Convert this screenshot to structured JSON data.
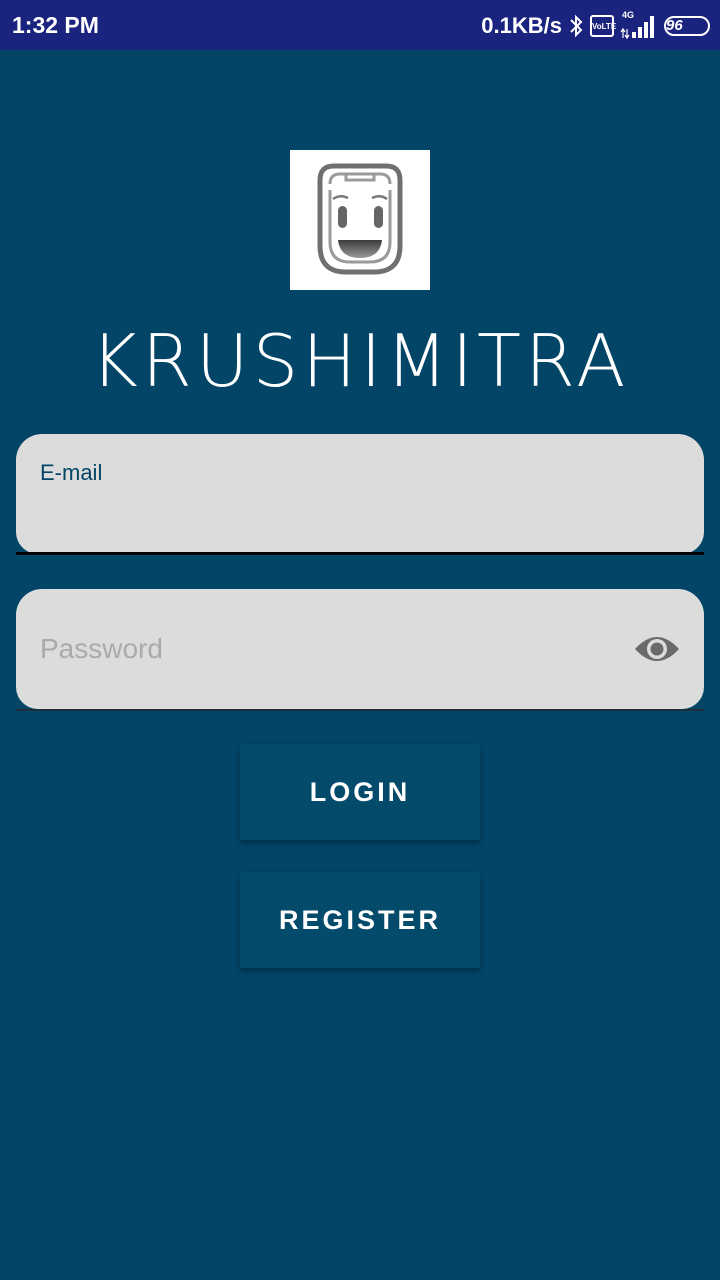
{
  "status_bar": {
    "time": "1:32 PM",
    "speed": "0.1KB/s",
    "volte_top": "Vo",
    "volte_bottom": "LTE",
    "network": "4G",
    "battery": "96",
    "icons": [
      "bluetooth-icon",
      "volte-icon",
      "signal-icon",
      "battery-icon"
    ]
  },
  "app": {
    "logo": "smiley-robot-logo",
    "title": "KRUSHIMITRA"
  },
  "form": {
    "email_label": "E-mail",
    "email_value": "",
    "password_placeholder": "Password",
    "password_toggle_icon": "eye-icon"
  },
  "buttons": {
    "login": "LOGIN",
    "register": "REGISTER"
  },
  "colors": {
    "background": "#024566",
    "status_bar": "#1a237e",
    "field": "#dcdcdc",
    "button": "#034a6b"
  }
}
